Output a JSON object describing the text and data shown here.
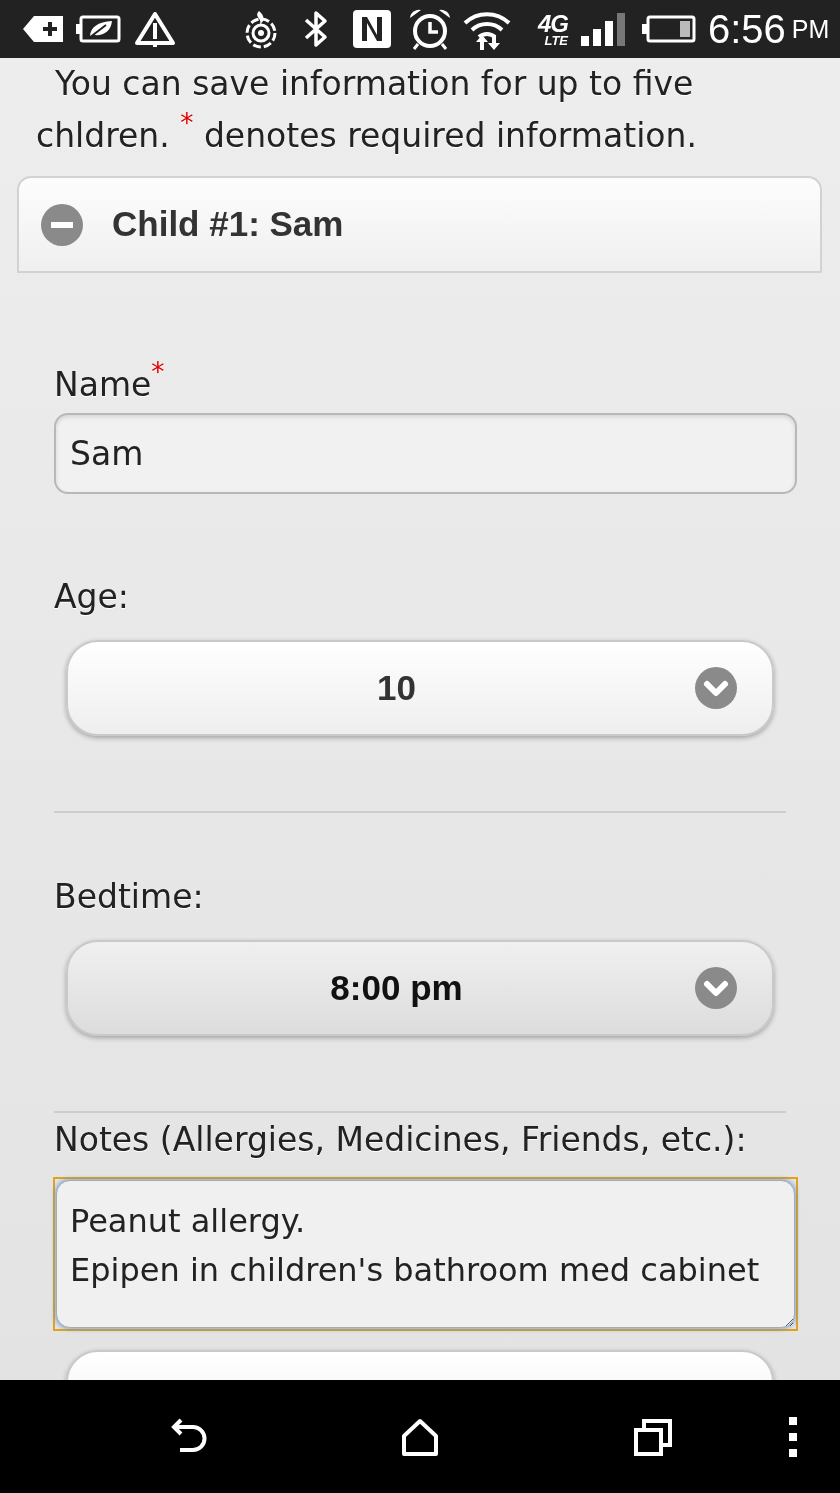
{
  "status_bar": {
    "network_generation": "4G",
    "network_tech": "LTE",
    "time": "6:56",
    "meridiem": "PM"
  },
  "intro": "You can save information for up to five chldren. $^{*}$ denotes required information.",
  "section": {
    "title": "Child #1: Sam",
    "expanded": true
  },
  "fields": [
    {
      "kind": "text",
      "label": "Name$^{*}$",
      "value": "Sam"
    },
    {
      "kind": "select",
      "label": "Age:",
      "value": "10",
      "pressed": false
    },
    {
      "kind": "select",
      "label": "Bedtime:",
      "value": "8:00 pm",
      "pressed": true
    },
    {
      "kind": "textarea",
      "label": "Notes (Allergies, Medicines, Friends, etc.):",
      "value_lines": [
        "Peanut allergy.",
        "Epipen in children's bathroom med cabinet"
      ],
      "focused": true
    },
    {
      "kind": "select",
      "pressed": false
    }
  ]
}
